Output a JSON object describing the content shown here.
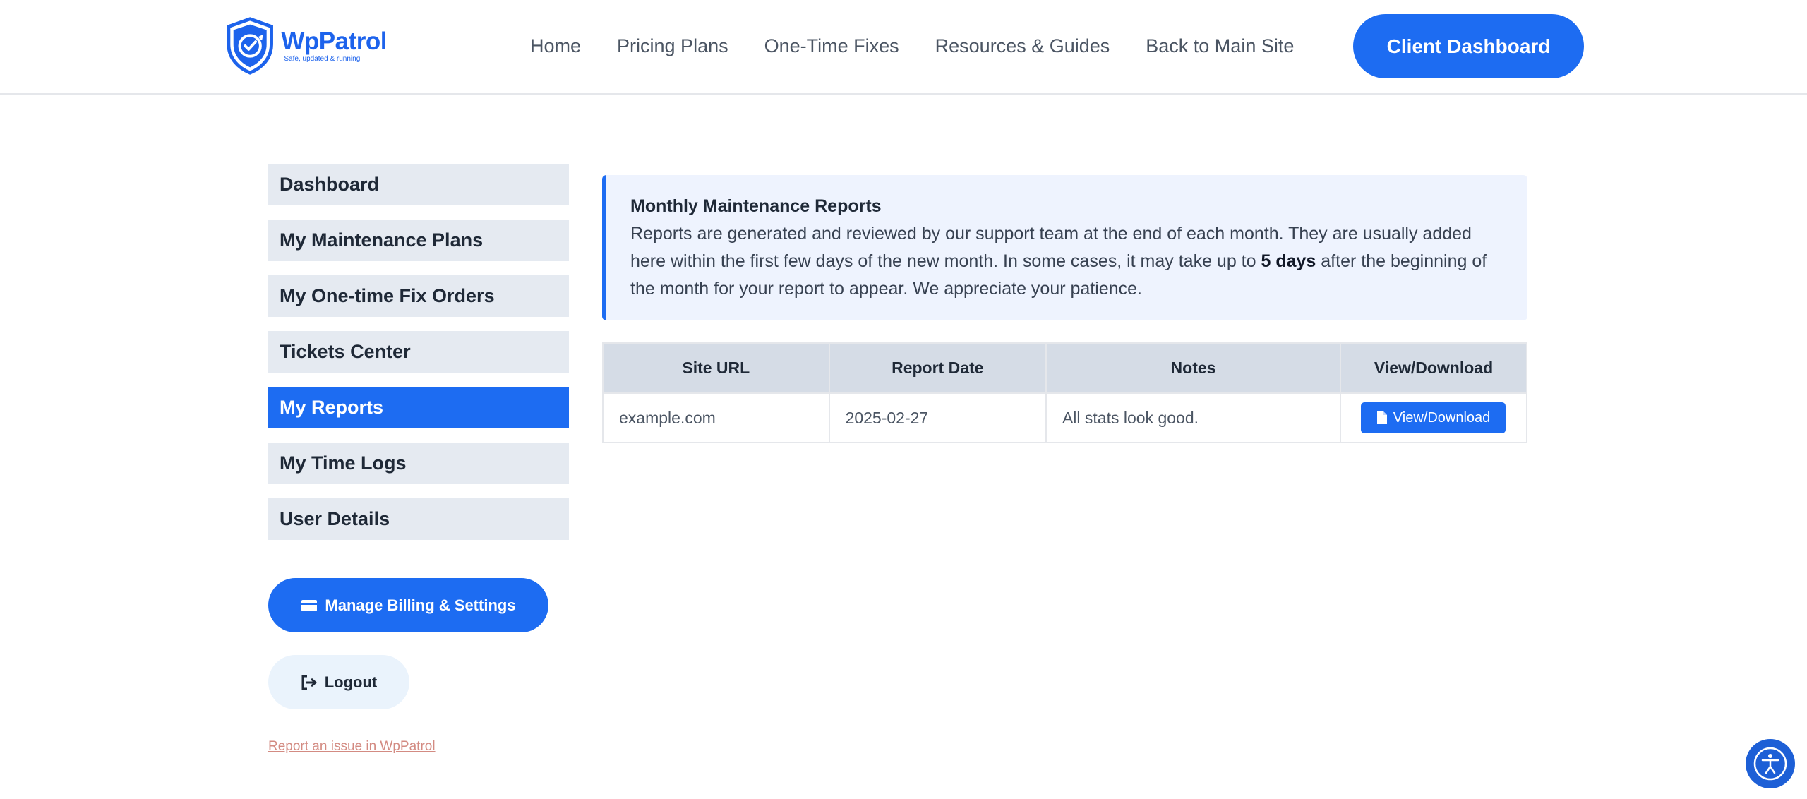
{
  "brand": {
    "name": "WpPatrol",
    "tagline": "Safe, updated & running",
    "color": "#1d63ec"
  },
  "nav": {
    "items": [
      "Home",
      "Pricing Plans",
      "One-Time Fixes",
      "Resources & Guides",
      "Back to Main Site"
    ],
    "cta": "Client Dashboard"
  },
  "sidebar": {
    "items": [
      {
        "label": "Dashboard",
        "active": false
      },
      {
        "label": "My Maintenance Plans",
        "active": false
      },
      {
        "label": "My One-time Fix Orders",
        "active": false
      },
      {
        "label": "Tickets Center",
        "active": false
      },
      {
        "label": "My Reports",
        "active": true
      },
      {
        "label": "My Time Logs",
        "active": false
      },
      {
        "label": "User Details",
        "active": false
      }
    ],
    "billing_label": "Manage Billing & Settings",
    "billing_icon": "credit-card-icon",
    "logout_label": "Logout",
    "logout_icon": "logout-icon",
    "report_issue": "Report an issue in WpPatrol"
  },
  "notice": {
    "title": "Monthly Maintenance Reports",
    "body_before": "Reports are generated and reviewed by our support team at the end of each month. They are usually added here within the first few days of the new month. In some cases, it may take up to ",
    "body_bold": "5 days",
    "body_after": " after the beginning of the month for your report to appear. We appreciate your patience."
  },
  "table": {
    "headers": [
      "Site URL",
      "Report Date",
      "Notes",
      "View/Download"
    ],
    "rows": [
      {
        "site": "example.com",
        "date": "2025-02-27",
        "notes": "All stats look good.",
        "action": "View/Download",
        "action_icon": "document-icon"
      }
    ]
  },
  "colors": {
    "accent": "#1d6cf2",
    "sidebar_bg": "#e5eaf1",
    "notice_bg": "#eef3fe",
    "table_header_bg": "#d5dce6"
  }
}
